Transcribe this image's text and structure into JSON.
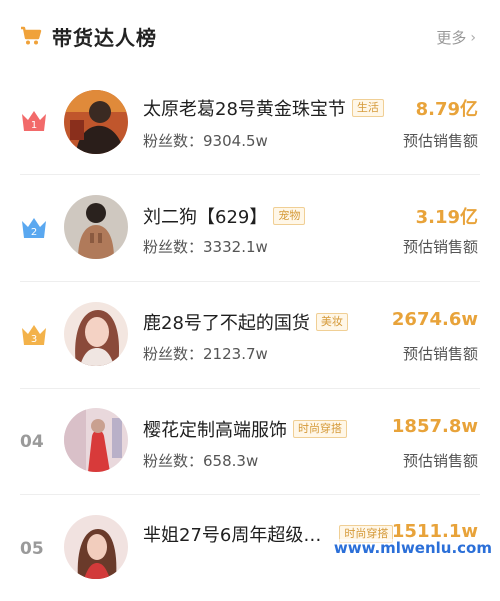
{
  "header": {
    "title": "带货达人榜",
    "more_label": "更多",
    "icon": "shopping-cart-icon",
    "accent_color": "#f0a23a"
  },
  "ranking": [
    {
      "rank": "1",
      "badge_color": "#f26a6a",
      "name": "太原老葛28号黄金珠宝节",
      "tag": "生活",
      "fans_label": "粉丝数：",
      "fans": "9304.5w",
      "sales": "8.79亿",
      "sales_label": "预估销售额"
    },
    {
      "rank": "2",
      "badge_color": "#5aa8f0",
      "name": "刘二狗【629】",
      "tag": "宠物",
      "fans_label": "粉丝数：",
      "fans": "3332.1w",
      "sales": "3.19亿",
      "sales_label": "预估销售额"
    },
    {
      "rank": "3",
      "badge_color": "#f3b24a",
      "name": "鹿28号了不起的国货",
      "tag": "美妆",
      "fans_label": "粉丝数：",
      "fans": "2123.7w",
      "sales": "2674.6w",
      "sales_label": "预估销售额"
    },
    {
      "rank": "04",
      "name": "樱花定制高端服饰",
      "tag": "时尚穿搭",
      "fans_label": "粉丝数：",
      "fans": "658.3w",
      "sales": "1857.8w",
      "sales_label": "预估销售额"
    },
    {
      "rank": "05",
      "name": "芈姐27号6周年超级…",
      "tag": "时尚穿搭",
      "fans_label": "粉丝数：",
      "fans": "",
      "sales": "1511.1w",
      "sales_label": ""
    }
  ],
  "watermark": "www.mlwenlu.com"
}
